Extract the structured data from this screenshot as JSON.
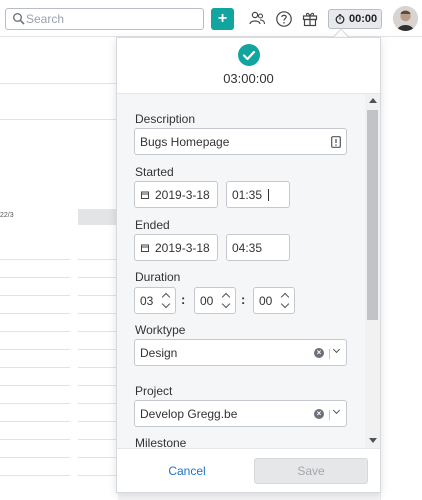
{
  "search": {
    "placeholder": "Search"
  },
  "header": {
    "add_label": "+",
    "timer": "00:00"
  },
  "background": {
    "date_fragment": "22/3"
  },
  "popover": {
    "total_duration": "03:00:00",
    "description": {
      "label": "Description",
      "value": "Bugs Homepage"
    },
    "started": {
      "label": "Started",
      "date": "2019-3-18",
      "time": "01:35"
    },
    "ended": {
      "label": "Ended",
      "date": "2019-3-18",
      "time": "04:35"
    },
    "duration": {
      "label": "Duration",
      "hours": "03",
      "minutes": "00",
      "seconds": "00",
      "separator": ":"
    },
    "worktype": {
      "label": "Worktype",
      "value": "Design"
    },
    "project": {
      "label": "Project",
      "value": "Develop Gregg.be"
    },
    "milestone": {
      "label": "Milestone"
    },
    "cancel_label": "Cancel",
    "save_label": "Save"
  },
  "colors": {
    "accent": "#12a5a0",
    "link": "#1b73c9"
  }
}
